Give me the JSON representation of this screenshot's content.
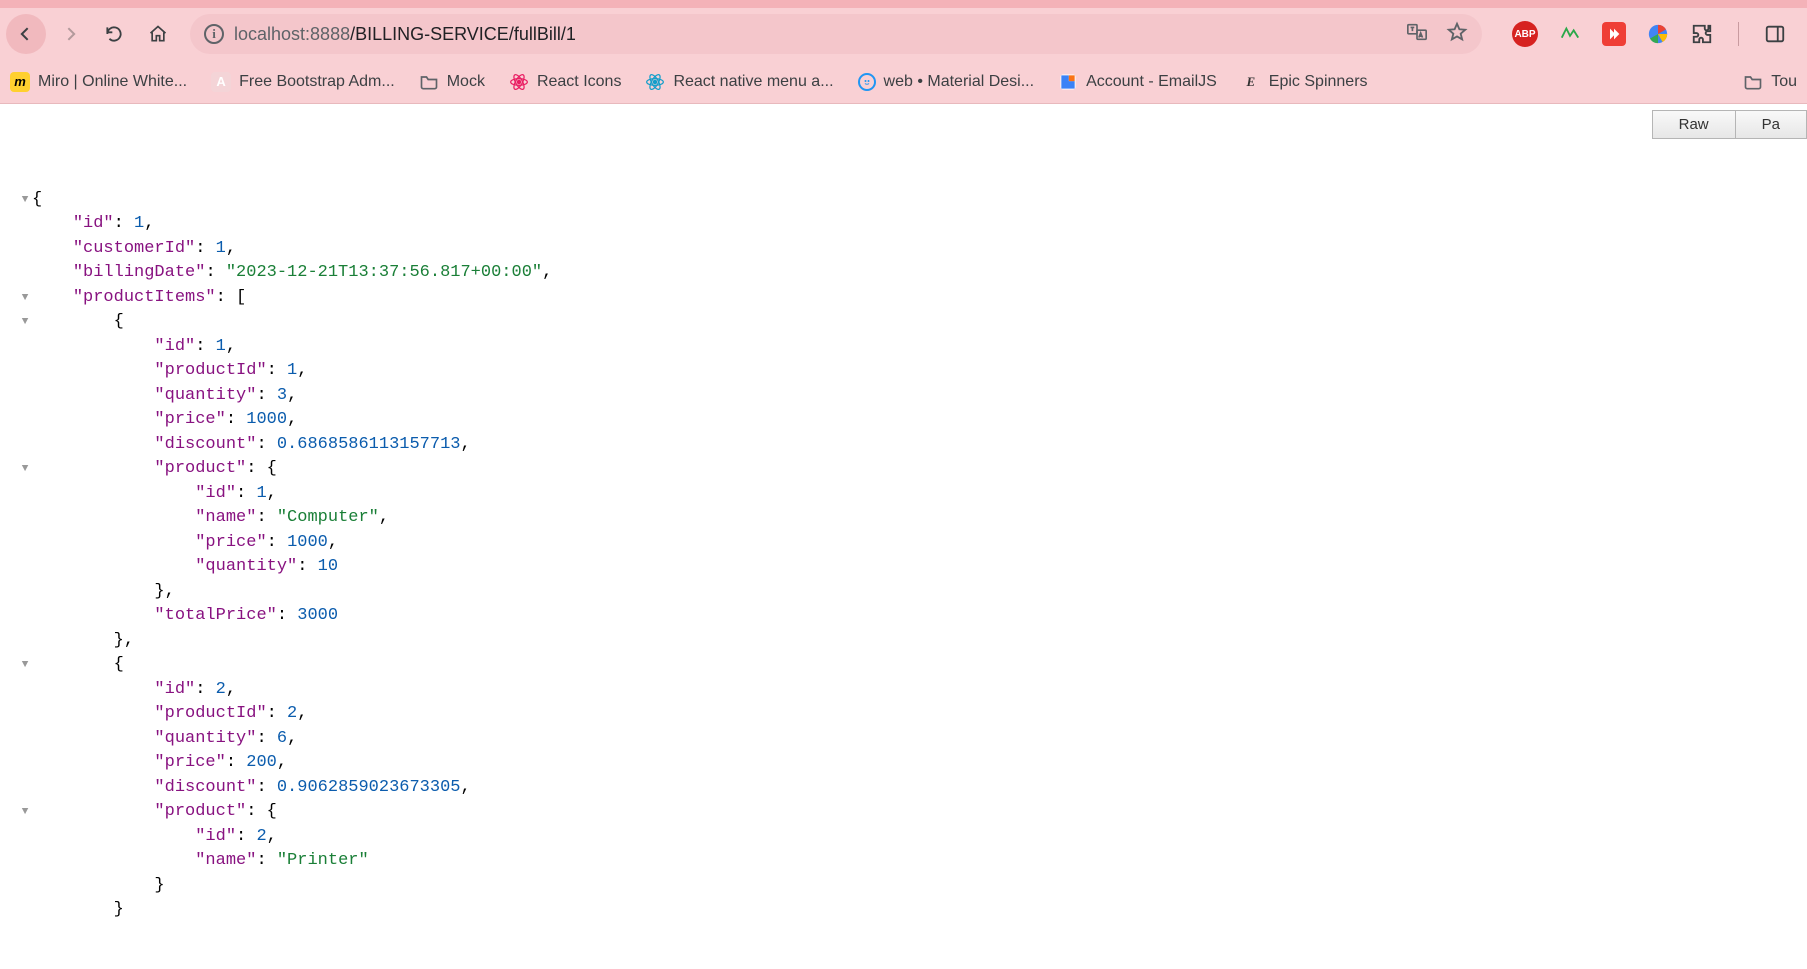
{
  "toolbar": {
    "url_host": "localhost",
    "url_port": ":8888",
    "url_path": "/BILLING-SERVICE/fullBill/1"
  },
  "bookmarks": [
    {
      "icon": "miro",
      "label": "Miro | Online White..."
    },
    {
      "icon": "a",
      "label": "Free Bootstrap Adm..."
    },
    {
      "icon": "folder",
      "label": "Mock"
    },
    {
      "icon": "react",
      "label": "React Icons"
    },
    {
      "icon": "react-blue",
      "label": "React native menu a..."
    },
    {
      "icon": "smile",
      "label": "web • Material Desi..."
    },
    {
      "icon": "emailjs",
      "label": "Account - EmailJS"
    },
    {
      "icon": "epic",
      "label": "Epic Spinners"
    }
  ],
  "bookmarks_right": {
    "icon": "folder",
    "label": "Tou"
  },
  "buttons": {
    "raw": "Raw",
    "parsed": "Pa"
  },
  "json": {
    "id": 1,
    "customerId": 1,
    "billingDate": "2023-12-21T13:37:56.817+00:00",
    "productItems": [
      {
        "id": 1,
        "productId": 1,
        "quantity": 3,
        "price": 1000,
        "discount": 0.6868586113157713,
        "product": {
          "id": 1,
          "name": "Computer",
          "price": 1000,
          "quantity": 10
        },
        "totalPrice": 3000
      },
      {
        "id": 2,
        "productId": 2,
        "quantity": 6,
        "price": 200,
        "discount": 0.9062859023673305,
        "product": {
          "id": 2,
          "name": "Printer"
        }
      }
    ]
  }
}
